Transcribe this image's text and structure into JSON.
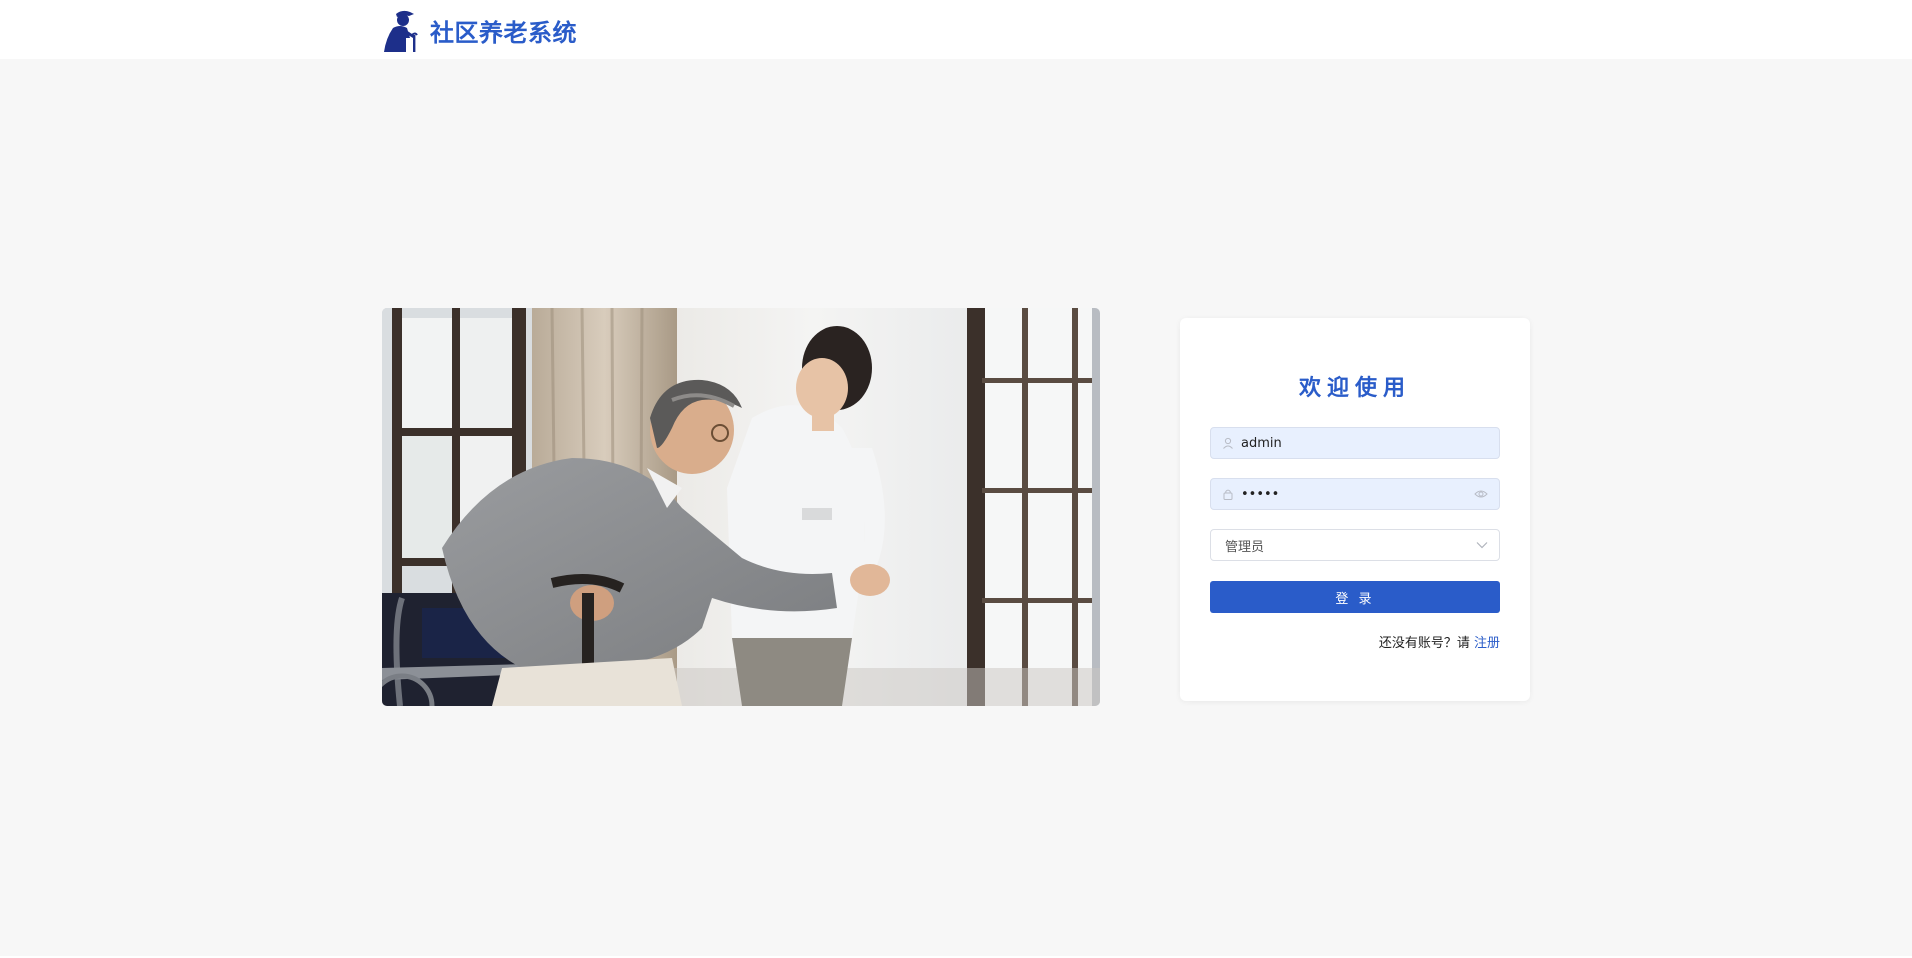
{
  "header": {
    "logo_icon": "elderly-person-icon",
    "app_title": "社区养老系统"
  },
  "hero": {
    "image_desc_icon": "caregiver-photo"
  },
  "login": {
    "title": "欢迎使用",
    "username": {
      "icon": "user-icon",
      "value": "admin"
    },
    "password": {
      "icon": "lock-icon",
      "value": "•••••",
      "toggle_icon": "eye-icon"
    },
    "role": {
      "selected": "管理员",
      "chevron_icon": "chevron-down-icon"
    },
    "submit_label": "登 录",
    "register_prompt": "还没有账号？请 ",
    "register_link": "注册"
  },
  "colors": {
    "accent": "#2a5cc9",
    "background": "#f7f7f7",
    "input_fill": "#e8f0fe"
  }
}
